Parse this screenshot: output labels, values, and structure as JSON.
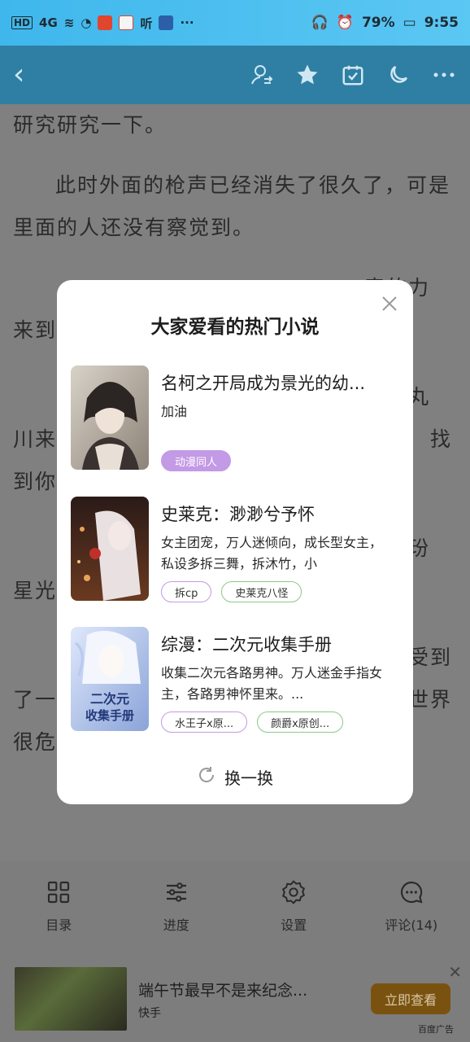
{
  "status_bar": {
    "network": "HD",
    "signal": "4G",
    "battery": "79%",
    "time": "9:55"
  },
  "reader": {
    "paragraphs": [
      "研究研究一下。",
      "此时外面的枪声已经消失了很久了，可是里面的人还没有察觉到。",
      "　　　　　　　　　　　　　　　　奇的力　　　　　　　　　　　　　　　　来到了",
      "　　　　　　　　　　　　　　　　大蛇丸　　　　　　　　　　　　　　　　川来也　　　　　　　　　　　　　　　　找到你",
      "　　　　　　　　　　　　　　　　控衫玢　　　　　　　　　　　　　　　　星光。",
      "　　　　　　　　　　　　　　　　轻感受到了一种来自灵魂深处的恐惧，这个所谓的世界很危险"
    ]
  },
  "toolbar": {
    "items": [
      {
        "label": "目录",
        "icon": "catalog-icon"
      },
      {
        "label": "进度",
        "icon": "progress-icon"
      },
      {
        "label": "设置",
        "icon": "settings-icon"
      },
      {
        "label": "评论(14)",
        "icon": "comment-icon"
      }
    ]
  },
  "ad": {
    "title": "端午节最早不是来纪念...",
    "source": "快手",
    "cta": "立即查看",
    "label": "百度广告"
  },
  "modal": {
    "title": "大家爱看的热门小说",
    "refresh_label": "换一换",
    "books": [
      {
        "name": "名柯之开局成为景光的幼...",
        "desc": "加油",
        "tags": [
          {
            "text": "动漫同人",
            "style": "fill"
          }
        ]
      },
      {
        "name": "史莱克：渺渺兮予怀",
        "desc": "女主团宠，万人迷倾向，成长型女主，私设多拆三舞，拆沐竹，小",
        "tags": [
          {
            "text": "拆cp",
            "style": "purple"
          },
          {
            "text": "史莱克八怪",
            "style": "green"
          }
        ]
      },
      {
        "name": "综漫：二次元收集手册",
        "desc": "收集二次元各路男神。万人迷金手指女主，各路男神怀里来。...",
        "tags": [
          {
            "text": "水王子x原...",
            "style": "purple"
          },
          {
            "text": "颜爵x原创...",
            "style": "green"
          }
        ]
      }
    ],
    "cover3_text": "二次元收集手册"
  }
}
